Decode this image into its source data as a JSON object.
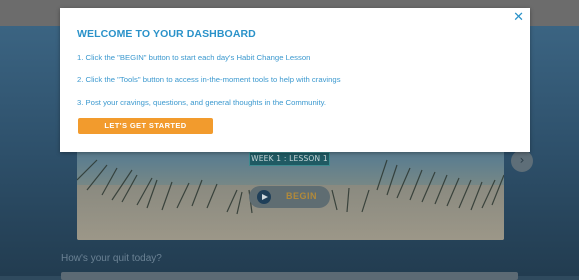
{
  "background": {
    "hero": {
      "lesson_badge": "WEEK 1 : LESSON 1",
      "begin_label": "BEGIN",
      "next_icon": "chevron-right-icon",
      "play_icon": "play-icon"
    },
    "quit_heading": "How's your quit today?"
  },
  "modal": {
    "close_icon": "close-icon",
    "close_glyph": "✕",
    "title": "WELCOME TO YOUR DASHBOARD",
    "steps": [
      "1. Click the \"BEGIN\" button to start each day's Habit Change Lesson",
      "2. Click the \"Tools\" button to access in-the-moment tools to help with cravings",
      "3. Post your cravings, questions, and general thoughts in the Community."
    ],
    "cta_label": "LET'S GET STARTED"
  },
  "colors": {
    "accent_blue": "#2a92c9",
    "cta_orange": "#f29b2d",
    "overlay_dark": "#2f4a5e"
  }
}
